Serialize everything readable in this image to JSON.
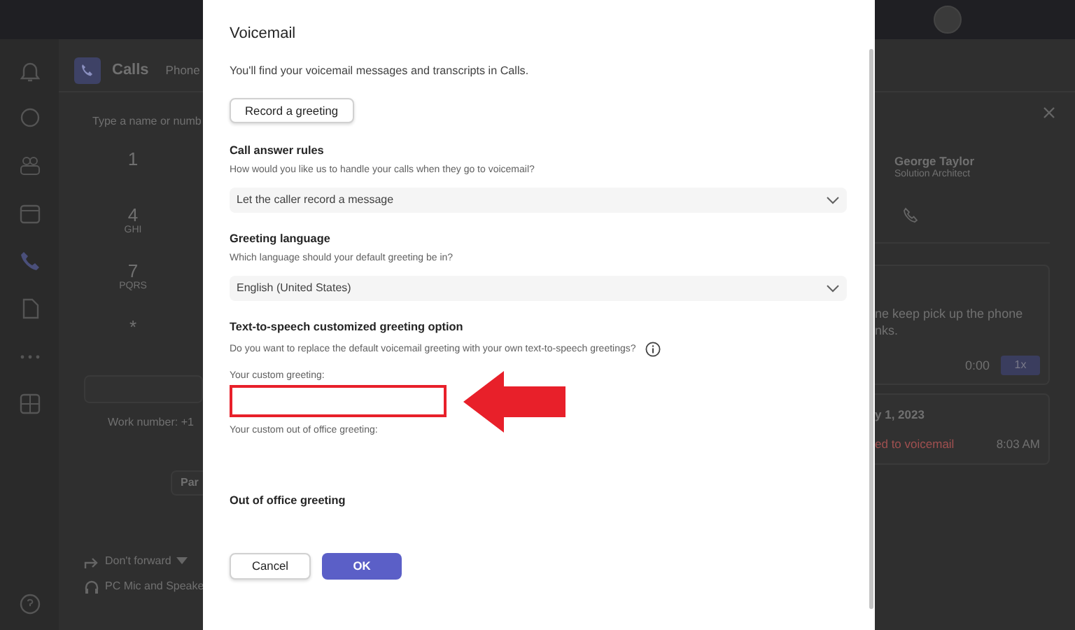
{
  "background": {
    "calls_header": {
      "title": "Calls",
      "tab": "Phone"
    },
    "dialer": {
      "placeholder": "Type a name or numb",
      "keys": [
        {
          "digit": "1"
        },
        {
          "digit": "4",
          "letters": "GHI"
        },
        {
          "digit": "7",
          "letters": "PQRS"
        },
        {
          "digit": "*"
        }
      ],
      "work_number": "Work number: +1",
      "park_button": "Par",
      "forwarding": "Don't forward",
      "device": "PC Mic and Speake"
    },
    "contact": {
      "name": "George Taylor",
      "role": "Solution Architect"
    },
    "voicemail_card": {
      "lines": [
        "ne keep pick up the phone",
        "nks."
      ],
      "time": "0:00",
      "speed": "1x"
    },
    "history_card": {
      "date": "y 1, 2023",
      "status": "ed to voicemail",
      "time": "8:03 AM"
    }
  },
  "dialog": {
    "title": "Voicemail",
    "intro": "You'll find your voicemail messages and transcripts in Calls.",
    "record_button": "Record a greeting",
    "sections": [
      {
        "kind": "select",
        "heading": "Call answer rules",
        "question": "How would you like us to handle your calls when they go to voicemail?",
        "value": "Let the caller record a message"
      },
      {
        "kind": "select",
        "heading": "Greeting language",
        "question": "Which language should your default greeting be in?",
        "value": "English (United States)"
      },
      {
        "kind": "tts",
        "heading": "Text-to-speech customized greeting option",
        "question": "Do you want to replace the default voicemail greeting with your own text-to-speech greetings?",
        "fields": [
          {
            "label": "Your custom greeting:",
            "highlighted": true
          },
          {
            "label": "Your custom out of office greeting:"
          }
        ]
      },
      {
        "kind": "heading",
        "heading": "Out of office greeting"
      }
    ],
    "buttons": [
      {
        "label": "Cancel",
        "primary": false
      },
      {
        "label": "OK",
        "primary": true
      }
    ]
  }
}
